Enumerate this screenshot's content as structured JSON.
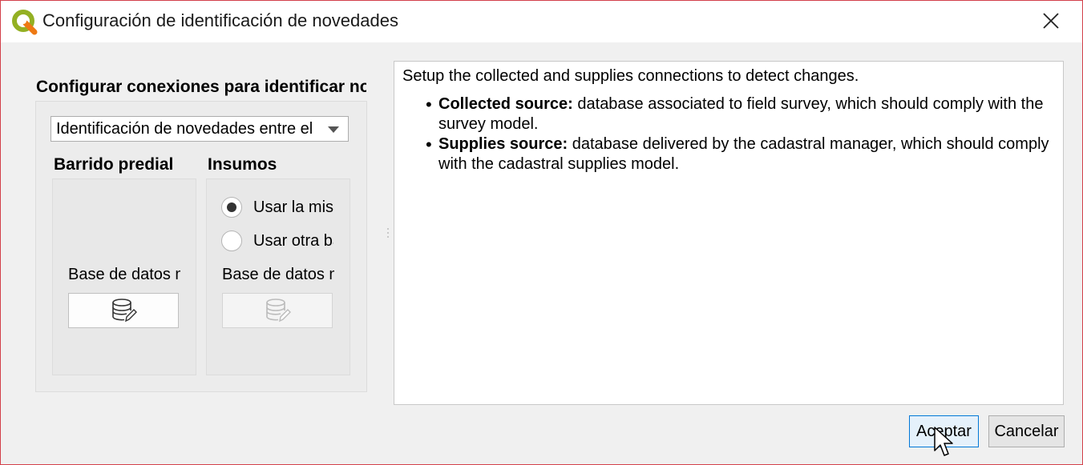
{
  "window": {
    "title": "Configuración de identificación de novedades",
    "app_icon": "qgis-logo-icon",
    "close_icon": "close-icon",
    "border_color": "#d3404a"
  },
  "config_group": {
    "title": "Configurar conexiones para identificar novedades",
    "combo": {
      "selected": "Identificación de novedades entre el barrido predial y los insumos"
    },
    "barrido": {
      "title": "Barrido predial",
      "db_label": "Base de datos manual",
      "db_button_icon": "database-edit-icon"
    },
    "insumos": {
      "title": "Insumos",
      "radio_same": "Usar la misma base de datos",
      "radio_other": "Usar otra base de datos",
      "db_label": "Base de datos manual",
      "db_button_icon": "database-edit-icon"
    }
  },
  "info": {
    "intro": "Setup the collected and supplies connections to detect changes.",
    "items": [
      {
        "term": "Collected source:",
        "text": " database associated to field survey, which should comply with the survey model."
      },
      {
        "term": "Supplies source:",
        "text": " database delivered by the cadastral manager, which should comply with the cadastral supplies model."
      }
    ]
  },
  "buttons": {
    "accept": "Aceptar",
    "cancel": "Cancelar"
  }
}
